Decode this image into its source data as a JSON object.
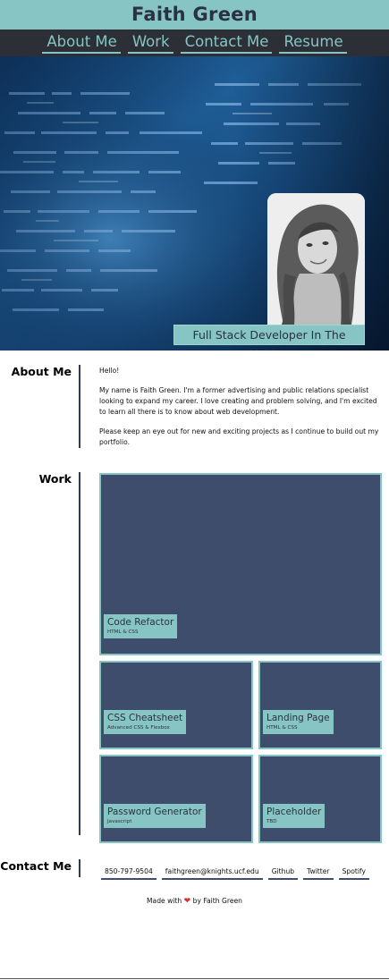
{
  "header": {
    "title": "Faith Green"
  },
  "nav": {
    "items": [
      {
        "label": "About Me"
      },
      {
        "label": "Work"
      },
      {
        "label": "Contact Me"
      },
      {
        "label": "Resume"
      }
    ]
  },
  "hero": {
    "tagline": "Full Stack Developer In The Making"
  },
  "about": {
    "heading": "About Me",
    "paragraphs": [
      "Hello!",
      "My name is Faith Green. I'm a former advertising and public relations specialist looking to expand my career. I love creating and problem solving, and I'm excited to learn all there is to know about web development.",
      "Please keep an eye out for new and exciting projects as I continue to build out my portfolio."
    ]
  },
  "work": {
    "heading": "Work",
    "projects": [
      {
        "title": "Code Refactor",
        "tech": "HTML & CSS"
      },
      {
        "title": "CSS Cheatsheet",
        "tech": "Advanced CSS & Flexbox"
      },
      {
        "title": "Landing Page",
        "tech": "HTML & CSS"
      },
      {
        "title": "Password Generator",
        "tech": "Javascript"
      },
      {
        "title": "Placeholder",
        "tech": "TBD"
      }
    ]
  },
  "contact": {
    "heading": "Contact Me",
    "links": [
      {
        "label": "850-797-9504"
      },
      {
        "label": "faithgreen@knights.ucf.edu"
      },
      {
        "label": "Github"
      },
      {
        "label": "Twitter"
      },
      {
        "label": "Spotify"
      }
    ]
  },
  "footer": {
    "prefix": "Made with",
    "suffix": "by Faith Green",
    "heart_icon": "heart-icon"
  },
  "colors": {
    "accent": "#86c5c3",
    "nav_bg": "#2c2f36",
    "card_bg": "#3e4d6c",
    "text_dark": "#2b3140",
    "heart": "#d9342b"
  }
}
